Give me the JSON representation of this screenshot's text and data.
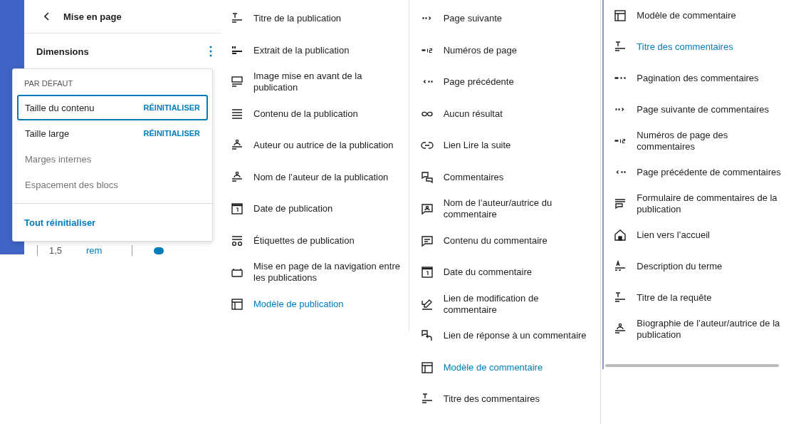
{
  "settings_panel": {
    "title": "Mise en page",
    "section": "Dimensions",
    "behind_values": [
      "1,5",
      "rem"
    ],
    "popover": {
      "heading": "PAR DÉFAUT",
      "items": [
        {
          "label": "Taille du contenu",
          "active": true,
          "selected": true,
          "reset": "RÉINITIALISER"
        },
        {
          "label": "Taille large",
          "active": true,
          "selected": false,
          "reset": "RÉINITIALISER"
        },
        {
          "label": "Marges internes",
          "active": false,
          "selected": false
        },
        {
          "label": "Espacement des blocs",
          "active": false,
          "selected": false
        }
      ],
      "reset_all": "Tout réinitialiser"
    }
  },
  "block_lists": [
    {
      "items": [
        {
          "label": "Titre de la publication",
          "kind": "title",
          "selected": false
        },
        {
          "label": "Extrait de la publication",
          "kind": "excerpt",
          "selected": false
        },
        {
          "label": "Image mise en avant de la publication",
          "kind": "image",
          "selected": false
        },
        {
          "label": "Contenu de la publication",
          "kind": "content",
          "selected": false
        },
        {
          "label": "Auteur ou autrice de la publication",
          "kind": "author",
          "selected": false
        },
        {
          "label": "Nom de l’auteur de la publication",
          "kind": "author",
          "selected": false
        },
        {
          "label": "Date de publication",
          "kind": "date",
          "selected": false
        },
        {
          "label": "Étiquettes de publication",
          "kind": "tags",
          "selected": false
        },
        {
          "label": "Mise en page de la navigation entre les publications",
          "kind": "nav",
          "selected": false
        },
        {
          "label": "Modèle de publication",
          "kind": "template",
          "selected": true
        }
      ]
    },
    {
      "items": [
        {
          "label": "Page suivante",
          "kind": "next",
          "selected": false
        },
        {
          "label": "Numéros de page",
          "kind": "numbers",
          "selected": false
        },
        {
          "label": "Page précédente",
          "kind": "previous",
          "selected": false
        },
        {
          "label": "Aucun résultat",
          "kind": "noresults",
          "selected": false
        },
        {
          "label": "Lien Lire la suite",
          "kind": "readmore",
          "selected": false
        },
        {
          "label": "Commentaires",
          "kind": "comments",
          "selected": false
        },
        {
          "label": "Nom de l’auteur/autrice du commentaire",
          "kind": "commentauthor",
          "selected": false
        },
        {
          "label": "Contenu du commentaire",
          "kind": "commentcontent",
          "selected": false
        },
        {
          "label": "Date du commentaire",
          "kind": "date",
          "selected": false
        },
        {
          "label": "Lien de modification de commentaire",
          "kind": "edit",
          "selected": false
        },
        {
          "label": "Lien de réponse à un commentaire",
          "kind": "reply",
          "selected": false
        },
        {
          "label": "Modèle de commentaire",
          "kind": "template",
          "selected": true
        },
        {
          "label": "Titre des commentaires",
          "kind": "title",
          "selected": false
        }
      ]
    },
    {
      "items": [
        {
          "label": "Modèle de commentaire",
          "kind": "template",
          "selected": false
        },
        {
          "label": "Titre des commentaires",
          "kind": "title",
          "selected": true
        },
        {
          "label": "Pagination des commentaires",
          "kind": "pagination",
          "selected": false
        },
        {
          "label": "Page suivante de commentaires",
          "kind": "next",
          "selected": false
        },
        {
          "label": "Numéros de page des commentaires",
          "kind": "numbers",
          "selected": false
        },
        {
          "label": "Page précédente de commentaires",
          "kind": "previous",
          "selected": false
        },
        {
          "label": "Formulaire de commentaires de la publication",
          "kind": "form",
          "selected": false
        },
        {
          "label": "Lien vers l’accueil",
          "kind": "home",
          "selected": false
        },
        {
          "label": "Description du terme",
          "kind": "termdesc",
          "selected": false
        },
        {
          "label": "Titre de la requête",
          "kind": "title",
          "selected": false
        },
        {
          "label": "Biographie de l’auteur/autrice de la publication",
          "kind": "bio",
          "selected": false
        }
      ]
    }
  ]
}
